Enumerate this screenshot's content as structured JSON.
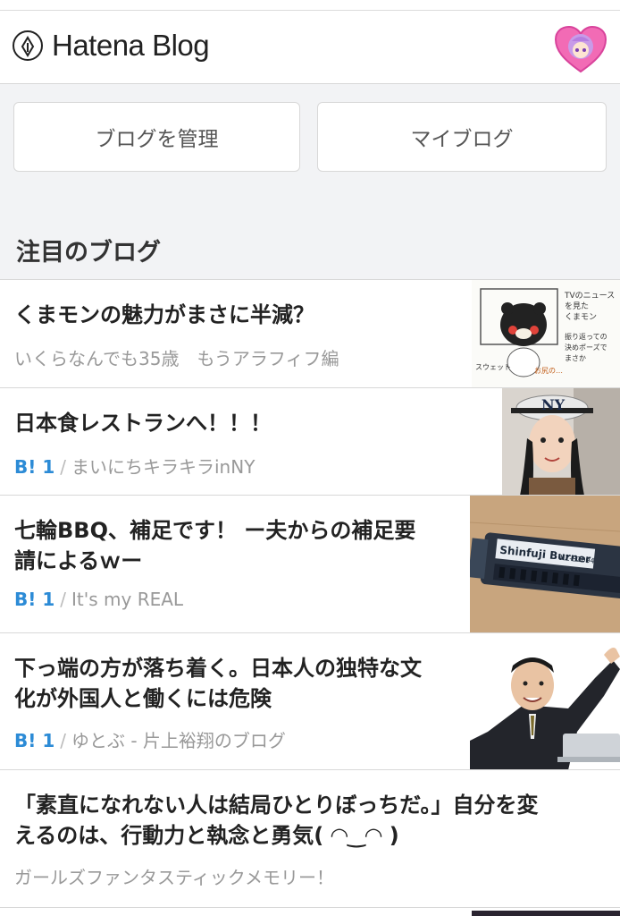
{
  "header": {
    "logo_text": "Hatena Blog",
    "logo_icon": "pen-nib-icon",
    "avatar": "user-avatar-heart"
  },
  "nav": {
    "manage_label": "ブログを管理",
    "my_blog_label": "マイブログ"
  },
  "section_title": "注目のブログ",
  "entries": [
    {
      "title": "くまモンの魅力がまさに半減？",
      "bookmarks": "",
      "blog": "いくらなんでも35歳　もうアラフィフ編"
    },
    {
      "title": "日本食レストランへ！！！",
      "bookmarks": "B! 1",
      "blog": "まいにちキラキラinNY"
    },
    {
      "title_lines": [
        "七輪BBQ、補足です！ ー夫からの補足要",
        "請によるｗー"
      ],
      "bookmarks": "B! 1",
      "blog": "It's my REAL"
    },
    {
      "title_lines": [
        "下っ端の方が落ち着く。日本人の独特な文",
        "化が外国人と働くには危険"
      ],
      "bookmarks": "B! 1",
      "blog": "ゆとぶ - 片上裕翔のブログ"
    },
    {
      "title_lines": [
        "「素直になれない人は結局ひとりぼっちだ。」自分を変",
        "えるのは、行動力と執念と勇気( ◠‿◠ )"
      ],
      "bookmarks": "",
      "blog": "ガールズファンタスティックメモリー！"
    }
  ],
  "thumb_labels": {
    "burner_text": "Shinfuji Burner",
    "burner_model": "KZ-S2094"
  }
}
